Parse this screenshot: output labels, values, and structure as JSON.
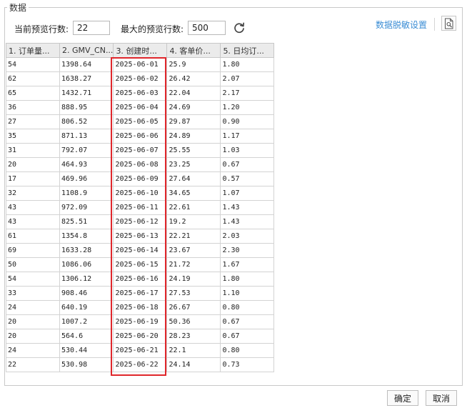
{
  "group_title": "数据",
  "current_rows": {
    "label": "当前预览行数:",
    "value": "22"
  },
  "max_rows": {
    "label": "最大的预览行数:",
    "value": "500"
  },
  "icons": {
    "refresh": "refresh-icon",
    "preview": "document-search-icon"
  },
  "desensitize_link": "数据脱敏设置",
  "highlight_color": "#e0262b",
  "table": {
    "columns": [
      "1. 订单量...",
      "2. GMV_CN...",
      "3. 创建时...",
      "4. 客单价...",
      "5. 日均订..."
    ],
    "rows": [
      [
        "54",
        "1398.64",
        "2025-06-01",
        "25.9",
        "1.80"
      ],
      [
        "62",
        "1638.27",
        "2025-06-02",
        "26.42",
        "2.07"
      ],
      [
        "65",
        "1432.71",
        "2025-06-03",
        "22.04",
        "2.17"
      ],
      [
        "36",
        "888.95",
        "2025-06-04",
        "24.69",
        "1.20"
      ],
      [
        "27",
        "806.52",
        "2025-06-05",
        "29.87",
        "0.90"
      ],
      [
        "35",
        "871.13",
        "2025-06-06",
        "24.89",
        "1.17"
      ],
      [
        "31",
        "792.07",
        "2025-06-07",
        "25.55",
        "1.03"
      ],
      [
        "20",
        "464.93",
        "2025-06-08",
        "23.25",
        "0.67"
      ],
      [
        "17",
        "469.96",
        "2025-06-09",
        "27.64",
        "0.57"
      ],
      [
        "32",
        "1108.9",
        "2025-06-10",
        "34.65",
        "1.07"
      ],
      [
        "43",
        "972.09",
        "2025-06-11",
        "22.61",
        "1.43"
      ],
      [
        "43",
        "825.51",
        "2025-06-12",
        "19.2",
        "1.43"
      ],
      [
        "61",
        "1354.8",
        "2025-06-13",
        "22.21",
        "2.03"
      ],
      [
        "69",
        "1633.28",
        "2025-06-14",
        "23.67",
        "2.30"
      ],
      [
        "50",
        "1086.06",
        "2025-06-15",
        "21.72",
        "1.67"
      ],
      [
        "54",
        "1306.12",
        "2025-06-16",
        "24.19",
        "1.80"
      ],
      [
        "33",
        "908.46",
        "2025-06-17",
        "27.53",
        "1.10"
      ],
      [
        "24",
        "640.19",
        "2025-06-18",
        "26.67",
        "0.80"
      ],
      [
        "20",
        "1007.2",
        "2025-06-19",
        "50.36",
        "0.67"
      ],
      [
        "20",
        "564.6",
        "2025-06-20",
        "28.23",
        "0.67"
      ],
      [
        "24",
        "530.44",
        "2025-06-21",
        "22.1",
        "0.80"
      ],
      [
        "22",
        "530.98",
        "2025-06-22",
        "24.14",
        "0.73"
      ]
    ]
  },
  "buttons": {
    "ok": "确定",
    "cancel": "取消"
  }
}
